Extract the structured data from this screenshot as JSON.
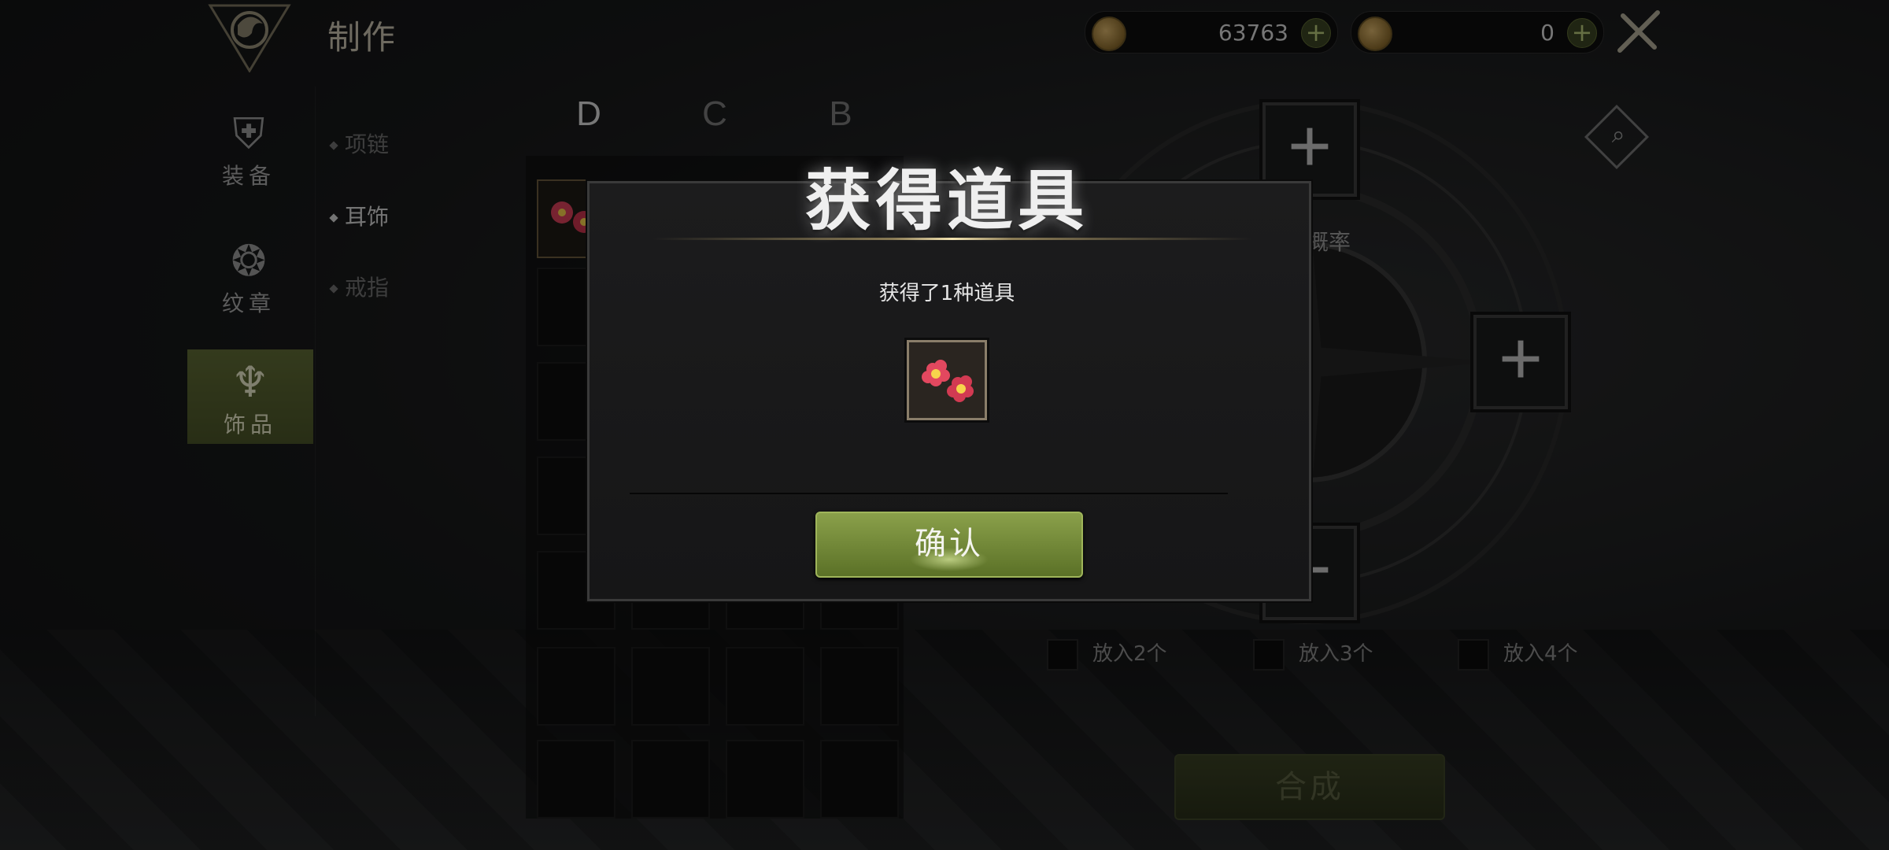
{
  "header": {
    "title": "制作",
    "currency_1": {
      "value": "63763",
      "add": "+"
    },
    "currency_2": {
      "value": "0",
      "add": "+"
    }
  },
  "category_nav": [
    {
      "label": "装备",
      "icon": "armor-icon"
    },
    {
      "label": "纹章",
      "icon": "crest-icon"
    },
    {
      "label": "饰品",
      "icon": "accessory-icon",
      "active": true
    }
  ],
  "sub_nav": [
    {
      "label": "项链"
    },
    {
      "label": "耳饰",
      "active": true
    },
    {
      "label": "戒指"
    }
  ],
  "grade_tabs": [
    "D",
    "C",
    "B"
  ],
  "craft": {
    "rate_label": "概率",
    "plus": "+",
    "options": [
      "放入2个",
      "放入3个",
      "放入4个"
    ],
    "synth_label": "合成"
  },
  "modal": {
    "title": "获得道具",
    "message": "获得了1种道具",
    "confirm_label": "确认"
  },
  "colors": {
    "accent": "#6f8434",
    "gold": "#c8a862"
  }
}
